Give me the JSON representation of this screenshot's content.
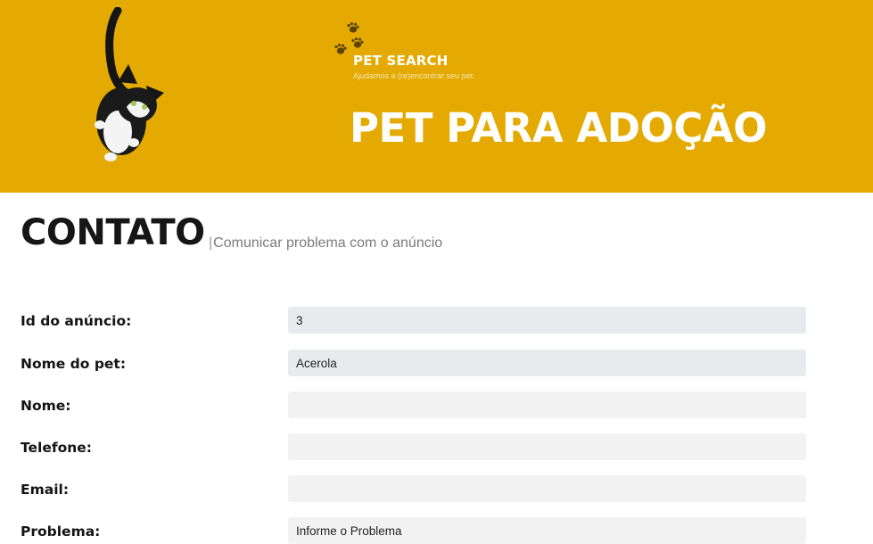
{
  "header": {
    "brand_name": "PET SEARCH",
    "brand_tagline": "Ajudamos a (re)encontrar seu pet.",
    "hero_title": "PET PARA ADOÇÃO",
    "background_color": "#e5aa01"
  },
  "contact": {
    "title": "CONTATO",
    "subtitle_separator": "|",
    "subtitle": "Comunicar problema com o anúncio"
  },
  "form": {
    "ad_id": {
      "label": "Id do anúncio:",
      "value": "3"
    },
    "pet_name": {
      "label": "Nome do pet:",
      "value": "Acerola"
    },
    "name": {
      "label": "Nome:",
      "value": ""
    },
    "phone": {
      "label": "Telefone:",
      "value": ""
    },
    "email": {
      "label": "Email:",
      "value": ""
    },
    "problem": {
      "label": "Problema:",
      "placeholder": "Informe o Problema"
    }
  },
  "icons": {
    "cat_photo": "cat-photo",
    "logo": "paw-prints-icon"
  }
}
